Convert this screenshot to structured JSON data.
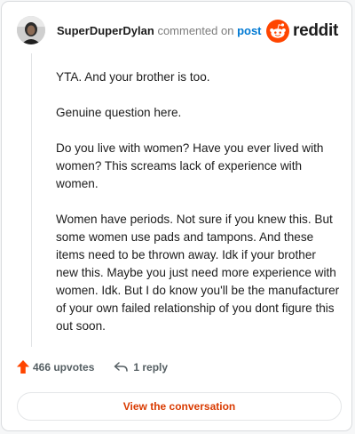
{
  "header": {
    "username": "SuperDuperDylan",
    "action_text": "commented on",
    "post_link": "post"
  },
  "brand": {
    "name": "reddit",
    "icon": "reddit-logo-icon",
    "color": "#ff4500"
  },
  "comment": {
    "paragraphs": [
      "YTA. And your brother is too.",
      "Genuine question here.",
      "Do you live with women? Have you ever lived with women? This screams lack of experience with women.",
      "Women have periods. Not sure if you knew this. But some women use pads and tampons. And these items need to be thrown away. Idk if your brother new this. Maybe you just need more experience with women. Idk. But I do know you'll be the manufacturer of your own failed relationship of you dont figure this out soon."
    ]
  },
  "actions": {
    "upvotes": "466 upvotes",
    "upvote_icon": "upvote-arrow-icon",
    "upvote_color": "#ff4500",
    "replies": "1 reply",
    "reply_icon": "reply-arrow-icon"
  },
  "cta": {
    "label": "View the conversation",
    "color": "#d93a00"
  }
}
